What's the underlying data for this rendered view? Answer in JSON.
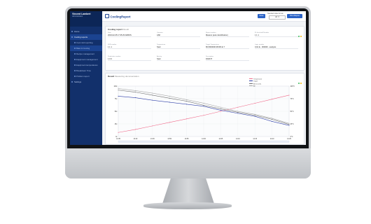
{
  "app": {
    "title": "CoolingReport",
    "sidebar_user": "Vincent Lambert",
    "sidebar_role": "Administrator",
    "save_button": "Save",
    "print_button": "Print Report",
    "time_format_label": "Standard date format",
    "time_format_value": "dd : 0"
  },
  "sidebar": {
    "items": [
      {
        "label": "Home",
        "active": false,
        "sub": false
      },
      {
        "label": "Cooling reports",
        "active": true,
        "sub": false
      },
      {
        "label": "Cool cold reporting",
        "active": false,
        "sub": true
      },
      {
        "label": "Blast & Cooling",
        "active": true,
        "sub": true
      },
      {
        "label": "Recipe management",
        "active": false,
        "sub": true
      },
      {
        "label": "Equipment management",
        "active": false,
        "sub": true
      },
      {
        "label": "Equipment temperatures",
        "active": false,
        "sub": true
      },
      {
        "label": "Breakdown Time",
        "active": false,
        "sub": true
      },
      {
        "label": "Problem report",
        "active": false,
        "sub": true
      },
      {
        "label": "Settings",
        "active": false,
        "sub": false
      }
    ]
  },
  "details": {
    "title": "Cooling report",
    "subtitle": "Result",
    "fields": [
      {
        "label": "Date",
        "value": "2023-02-05 17:35:25 ADBOS"
      },
      {
        "label": "Operator",
        "value": "ASK"
      },
      {
        "label": "Report number",
        "value": "Massno (auto identification)"
      },
      {
        "label": "ID threshold Number",
        "value": "1 1 1"
      },
      {
        "label": "SKB number",
        "value": "1 1 1"
      },
      {
        "label": "Temperature",
        "value": "Start"
      },
      {
        "label": "Target Temperature",
        "value": "80-5000000 RFIDS E 7"
      },
      {
        "label": "Logic number",
        "value": "0-91 E - 000000 - analysis"
      },
      {
        "label": "Production number",
        "value": "1 0 0"
      },
      {
        "label": "Activity",
        "value": "Start"
      },
      {
        "label": "Description",
        "value": "F00/FIT"
      }
    ]
  },
  "result": {
    "title": "Result",
    "subtitle": "Measuring documentation"
  },
  "chart_data": {
    "type": "line",
    "title": "",
    "x": [
      "13:35",
      "13:40",
      "13:45",
      "13:50",
      "13:55",
      "14:00",
      "14:05",
      "14:10",
      "14:15",
      "14:20",
      "14:25"
    ],
    "ylim_left": [
      0,
      100
    ],
    "ylim_right": [
      0,
      100
    ],
    "legend_position": "top-right",
    "series": [
      {
        "name": "Temperature",
        "color": "#f06a8a",
        "values": [
          8,
          14,
          21,
          28,
          35,
          42,
          50,
          58,
          66,
          74,
          82
        ]
      },
      {
        "name": "Target",
        "color": "#2f3fa8",
        "values": [
          80,
          77,
          72,
          68,
          64,
          60,
          52,
          46,
          40,
          30,
          22
        ]
      },
      {
        "name": "All seconds",
        "color": "#6c6c6c",
        "values": [
          92,
          88,
          82,
          76,
          70,
          62,
          55,
          48,
          42,
          34,
          24
        ]
      },
      {
        "name": "All",
        "color": "#a7a7a7",
        "values": [
          95,
          91,
          86,
          80,
          73,
          66,
          58,
          50,
          44,
          36,
          26
        ]
      }
    ],
    "left_ticks": [
      "100c",
      "75c",
      "50c",
      "25c",
      "0c"
    ],
    "right_ticks": [
      "100°C",
      "75°C",
      "50°C",
      "25°C",
      "0°C"
    ]
  }
}
